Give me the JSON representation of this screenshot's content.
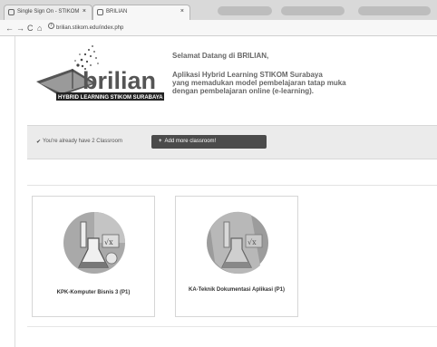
{
  "browser": {
    "tabs": [
      {
        "label": "Single Sign On - STIKOM",
        "active": false
      },
      {
        "label": "BRILIAN",
        "active": true
      }
    ],
    "url": "brilian.stikom.edu/index.php"
  },
  "header": {
    "logo_text": "brilian",
    "logo_subtitle": "HYBRID LEARNING STIKOM SURABAYA",
    "welcome": "Selamat Datang di BRILIAN,",
    "tagline_line1": "Aplikasi Hybrid Learning STIKOM Surabaya",
    "tagline_line2": "yang memadukan model pembelajaran tatap muka",
    "tagline_line3": "dengan pembelajaran online (e-learning)."
  },
  "info": {
    "message": "You're already have 2 Classroom",
    "add_button": "Add more classroom!"
  },
  "classrooms": [
    {
      "name": "KPK-Komputer Bisnis 3 (P1)"
    },
    {
      "name": "KA-Teknik Dokumentasi Aplikasi (P1)"
    }
  ],
  "icons": {
    "check": "check-icon",
    "plus": "plus-icon",
    "reload": "reload-icon",
    "home": "home-icon",
    "info": "info-icon"
  }
}
